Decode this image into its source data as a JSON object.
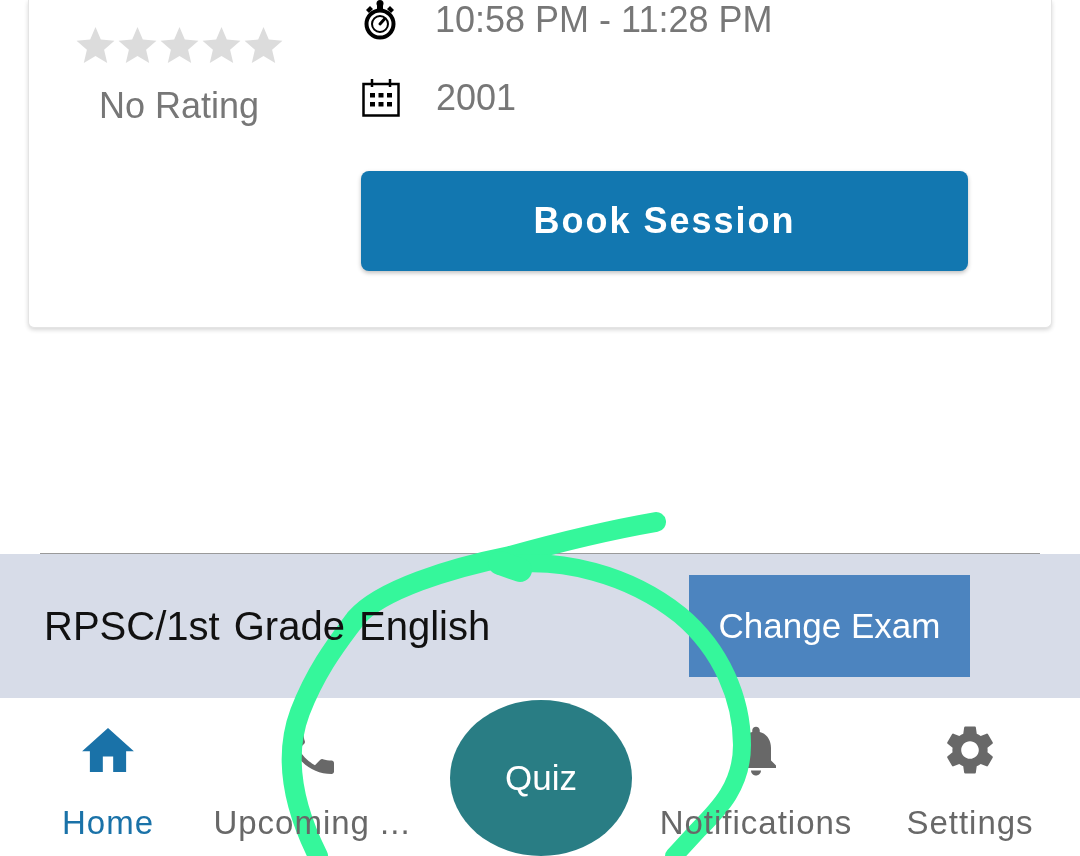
{
  "session_card": {
    "rating": {
      "stars": 0,
      "label": "No Rating"
    },
    "time": "10:58 PM - 11:28 PM",
    "date": "2001",
    "button": "Book Session"
  },
  "exam_bar": {
    "exam": "RPSC/1st Grade English",
    "button": "Change Exam"
  },
  "bottom_nav": [
    {
      "label": "Home",
      "kind": "tab",
      "selected": true
    },
    {
      "label": "Upcoming ...",
      "kind": "tab",
      "selected": false
    },
    {
      "label": "Quiz",
      "kind": "round",
      "selected": false
    },
    {
      "label": "Notifications",
      "kind": "tab",
      "selected": false
    },
    {
      "label": "Settings",
      "kind": "tab",
      "selected": false
    }
  ]
}
